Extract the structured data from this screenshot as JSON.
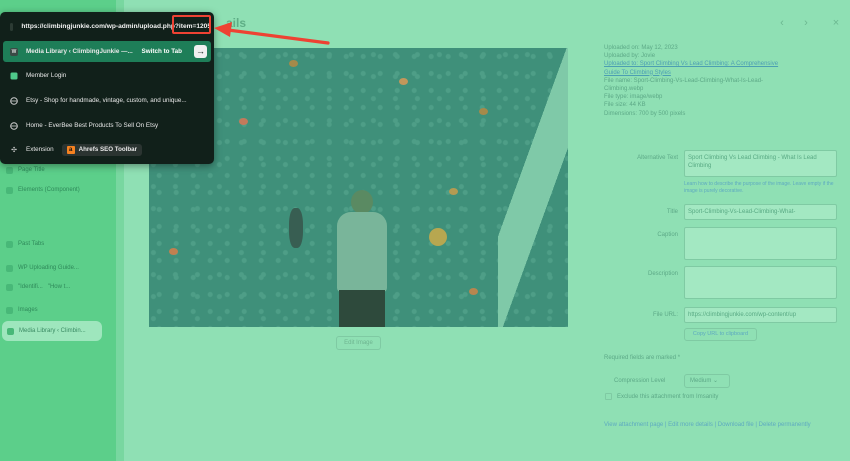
{
  "dropdown": {
    "url": "https://climbingjunkie.com/wp-admin/upload.php?item=1205",
    "suggestions": [
      {
        "label": "Media Library ‹ ClimbingJunkie —...",
        "action": "Switch to Tab",
        "selected": true
      },
      {
        "label": "Member Login"
      },
      {
        "label": "Etsy - Shop for handmade, vintage, custom, and unique..."
      },
      {
        "label": "Home - EverBee Best Products To Sell On Etsy"
      }
    ],
    "extension": {
      "prefix": "Extension",
      "name": "Ahrefs SEO Toolbar"
    }
  },
  "page": {
    "title_fragment": "ails",
    "edit_image": "Edit Image",
    "info_lines": [
      "Uploaded on: May 12, 2023",
      "Uploaded by: Jovie",
      "Uploaded to: Sport Climbing Vs Lead Climbing: A Comprehensive",
      "Guide To Climbing Styles",
      "File name: Sport-Climbing-Vs-Lead-Climbing-What-Is-Lead-",
      "Climbing.webp",
      "File type: image/webp",
      "File size: 44 KB",
      "Dimensions: 700 by 500 pixels"
    ],
    "fields": {
      "alt_label": "Alternative Text",
      "alt_value": "Sport Climbing Vs Lead Climbing - What Is Lead Climbing",
      "alt_help": "Learn how to describe the purpose of the image. Leave empty if the image is purely decorative.",
      "title_label": "Title",
      "title_value": "Sport-Climbing-Vs-Lead-Climbing-What-",
      "caption_label": "Caption",
      "description_label": "Description",
      "file_url_label": "File URL:",
      "file_url_value": "https://climbingjunkie.com/wp-content/up",
      "copy_url": "Copy URL to clipboard",
      "required_note": "Required fields are marked *",
      "compression_label": "Compression Level",
      "compression_value": "Medium",
      "exclude_label": "Exclude this attachment from Imsanity",
      "footer_links": "View attachment page | Edit more details | Download file | Delete permanently"
    }
  },
  "sidebar": {
    "items": [
      "Page Title",
      "Elements (Component)",
      "Past Tabs",
      "WP Uploading Guide...",
      "\"Identifi...",
      "\"How t...",
      "Images",
      "Media Library ‹ Climbin..."
    ]
  },
  "colors": {
    "annotation": "#ee4233",
    "selected_row": "#1e7e58",
    "dropdown_bg": "#11201a"
  }
}
